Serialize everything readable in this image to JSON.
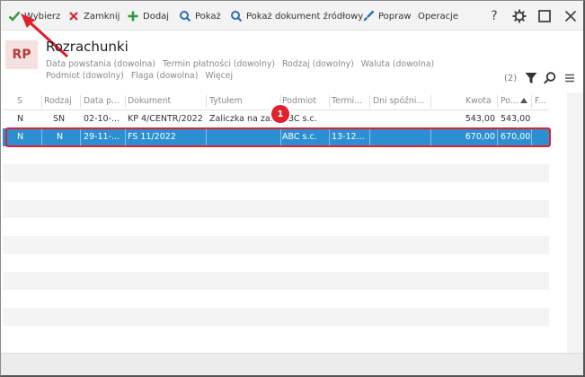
{
  "toolbar": {
    "select_label": "Wybierz",
    "close_label": "Zamknij",
    "add_label": "Dodaj",
    "show_label": "Pokaż",
    "show_source_label": "Pokaż dokument źródłowy",
    "edit_label": "Popraw",
    "operations_label": "Operacje",
    "help_label": "?"
  },
  "header": {
    "logo": "RP",
    "title": "Rozrachunki",
    "filters": [
      "Data powstania (dowolna)",
      "Termin płatności (dowolny)",
      "Rodzaj (dowolny)",
      "Waluta (dowolna)",
      "Podmiot (dowolny)",
      "Flaga (dowolna)",
      "Więcej"
    ],
    "count": "(2)"
  },
  "grid": {
    "columns": [
      "S",
      "Rodzaj",
      "Data p...",
      "Dokument",
      "Tytułem",
      "Podmiot",
      "Termi...",
      "Dni spóźni...",
      "Kwota",
      "Po...",
      "F..."
    ],
    "rows": [
      [
        "N",
        "SN",
        "02-10-...",
        "KP 4/CENTR/2022",
        "Zaliczka na za...",
        "ABC s.c.",
        "",
        "",
        "543,00",
        "543,00",
        ""
      ],
      [
        "N",
        "N",
        "29-11-...",
        "FS 11/2022",
        "",
        "ABC s.c.",
        "13-12...",
        "",
        "670,00",
        "670,00",
        ""
      ]
    ]
  },
  "annotation": {
    "badge": "1"
  },
  "colors": {
    "selection": "#2b8fd1",
    "highlight": "#e0212e",
    "logo_bg": "#f6e1e1",
    "logo_text": "#b23b3b"
  }
}
